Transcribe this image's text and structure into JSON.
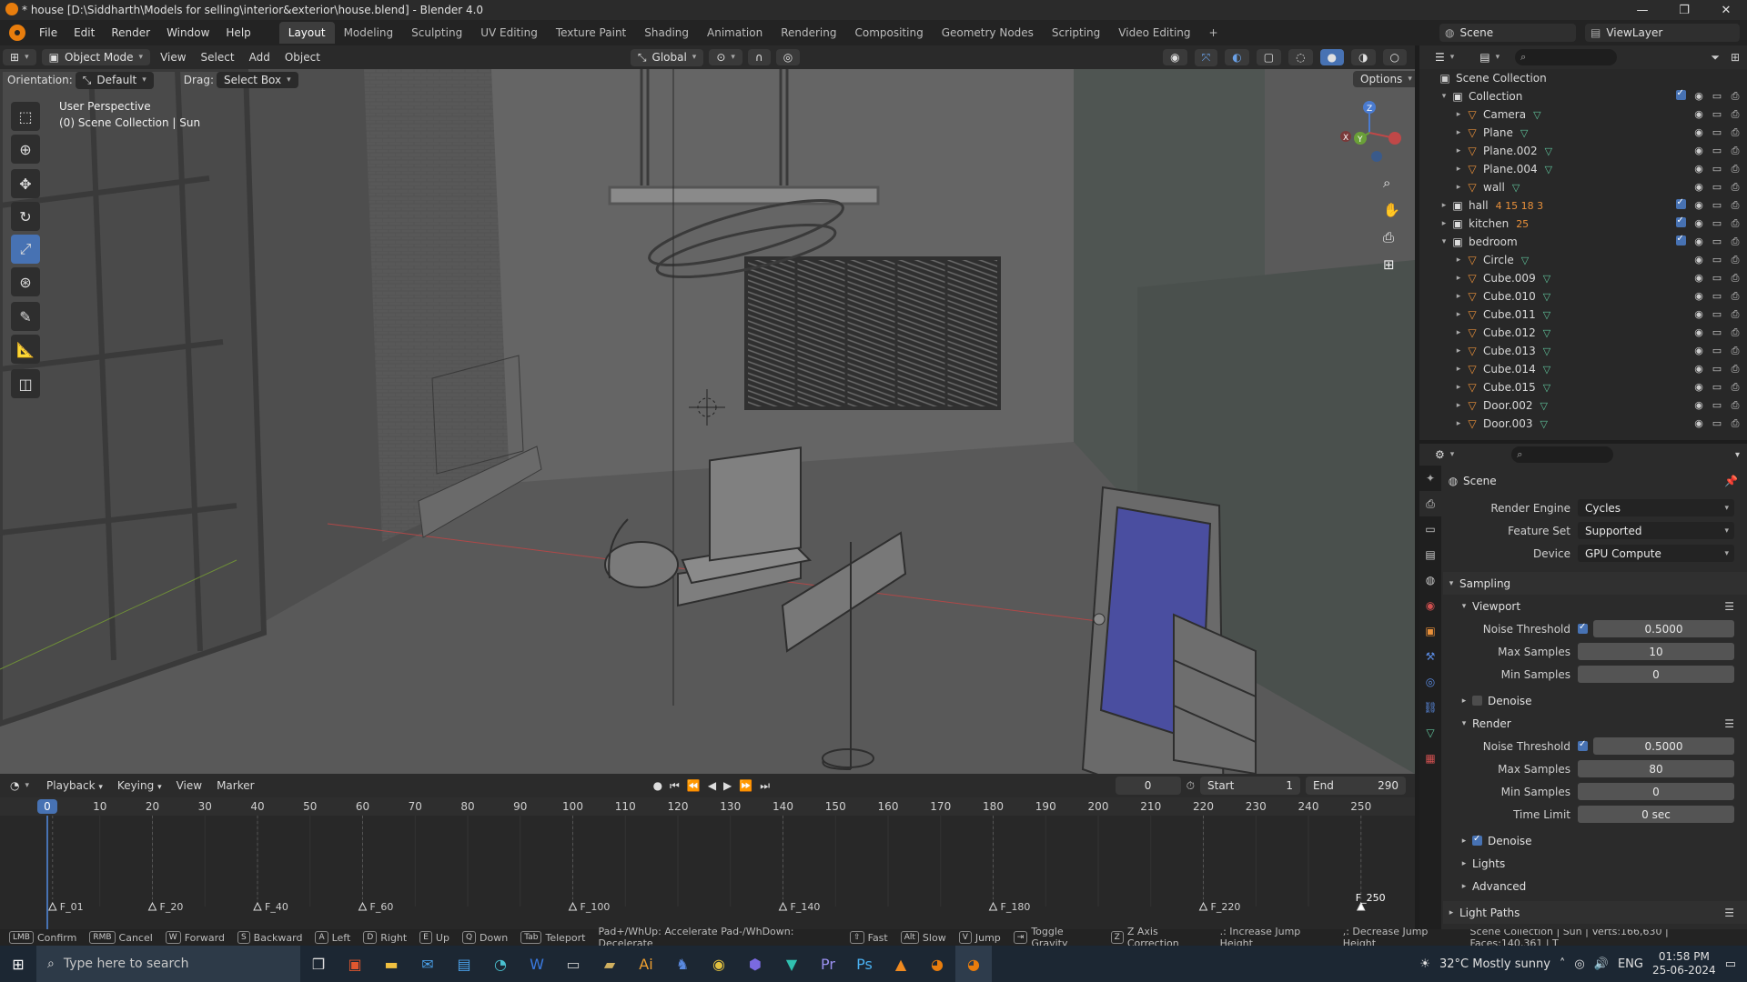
{
  "window": {
    "title": "* house [D:\\Siddharth\\Models for selling\\interior&exterior\\house.blend] - Blender 4.0",
    "minimize": "—",
    "maximize": "❐",
    "close": "✕"
  },
  "menu": {
    "items": [
      "File",
      "Edit",
      "Render",
      "Window",
      "Help"
    ],
    "workspaces": [
      "Layout",
      "Modeling",
      "Sculpting",
      "UV Editing",
      "Texture Paint",
      "Shading",
      "Animation",
      "Rendering",
      "Compositing",
      "Geometry Nodes",
      "Scripting",
      "Video Editing"
    ],
    "active_workspace": "Layout",
    "add_tab": "+",
    "scene": "Scene",
    "view_layer": "ViewLayer"
  },
  "viewport_header": {
    "mode": "Object Mode",
    "menus": [
      "View",
      "Select",
      "Add",
      "Object"
    ],
    "transform": "Global",
    "options": "Options"
  },
  "tool_header": {
    "orientation_label": "Orientation:",
    "orientation_value": "Default",
    "drag_label": "Drag:",
    "drag_value": "Select Box"
  },
  "viewport": {
    "perspective": "User Perspective",
    "context": "(0) Scene Collection | Sun",
    "gizmo": {
      "z": "Z",
      "y": "Y",
      "x": "X"
    }
  },
  "toolbar": {
    "tools": [
      "select-box-icon",
      "cursor-icon",
      "move-icon",
      "rotate-icon",
      "scale-icon",
      "transform-icon",
      "annotate-icon",
      "measure-icon",
      "add-cube-icon"
    ],
    "active_tool": "scale-icon"
  },
  "timeline": {
    "menus": [
      "Playback",
      "Keying",
      "View",
      "Marker"
    ],
    "current_frame": "0",
    "start_label": "Start",
    "start_value": "1",
    "end_label": "End",
    "end_value": "290",
    "ticks": [
      "0",
      "10",
      "20",
      "30",
      "40",
      "50",
      "60",
      "70",
      "80",
      "90",
      "100",
      "110",
      "120",
      "130",
      "140",
      "150",
      "160",
      "170",
      "180",
      "190",
      "200",
      "210",
      "220",
      "230",
      "240",
      "250"
    ],
    "markers": [
      "F_01",
      "F_20",
      "F_40",
      "F_60",
      "F_100",
      "F_140",
      "F_180",
      "F_220",
      "F_250"
    ]
  },
  "outliner": {
    "root": "Scene Collection",
    "rows": [
      {
        "name": "Collection",
        "level": 1,
        "type": "collection",
        "expanded": true
      },
      {
        "name": "Camera",
        "level": 2,
        "type": "object"
      },
      {
        "name": "Plane",
        "level": 2,
        "type": "object"
      },
      {
        "name": "Plane.002",
        "level": 2,
        "type": "object"
      },
      {
        "name": "Plane.004",
        "level": 2,
        "type": "object"
      },
      {
        "name": "wall",
        "level": 2,
        "type": "object"
      },
      {
        "name": "hall",
        "level": 1,
        "type": "collection",
        "expanded": false,
        "badges": "4 15 18 3"
      },
      {
        "name": "kitchen",
        "level": 1,
        "type": "collection",
        "expanded": false,
        "badges": "25"
      },
      {
        "name": "bedroom",
        "level": 1,
        "type": "collection",
        "expanded": true
      },
      {
        "name": "Circle",
        "level": 2,
        "type": "object"
      },
      {
        "name": "Cube.009",
        "level": 2,
        "type": "object"
      },
      {
        "name": "Cube.010",
        "level": 2,
        "type": "object"
      },
      {
        "name": "Cube.011",
        "level": 2,
        "type": "object"
      },
      {
        "name": "Cube.012",
        "level": 2,
        "type": "object"
      },
      {
        "name": "Cube.013",
        "level": 2,
        "type": "object"
      },
      {
        "name": "Cube.014",
        "level": 2,
        "type": "object"
      },
      {
        "name": "Cube.015",
        "level": 2,
        "type": "object"
      },
      {
        "name": "Door.002",
        "level": 2,
        "type": "object"
      },
      {
        "name": "Door.003",
        "level": 2,
        "type": "object"
      }
    ]
  },
  "properties": {
    "context": "Scene",
    "render_engine_label": "Render Engine",
    "render_engine": "Cycles",
    "feature_set_label": "Feature Set",
    "feature_set": "Supported",
    "device_label": "Device",
    "device": "GPU Compute",
    "sampling": "Sampling",
    "viewport": "Viewport",
    "vp_noise_label": "Noise Threshold",
    "vp_noise": "0.5000",
    "vp_max_label": "Max Samples",
    "vp_max": "10",
    "vp_min_label": "Min Samples",
    "vp_min": "0",
    "vp_denoise": "Denoise",
    "render": "Render",
    "r_noise_label": "Noise Threshold",
    "r_noise": "0.5000",
    "r_max_label": "Max Samples",
    "r_max": "80",
    "r_min_label": "Min Samples",
    "r_min": "0",
    "r_time_label": "Time Limit",
    "r_time": "0 sec",
    "r_denoise": "Denoise",
    "lights": "Lights",
    "advanced": "Advanced",
    "light_paths": "Light Paths"
  },
  "statusbar": {
    "items": [
      {
        "key": "LMB",
        "label": "Confirm"
      },
      {
        "key": "RMB",
        "label": "Cancel"
      },
      {
        "key": "W",
        "label": "Forward"
      },
      {
        "key": "S",
        "label": "Backward"
      },
      {
        "key": "A",
        "label": "Left"
      },
      {
        "key": "D",
        "label": "Right"
      },
      {
        "key": "E",
        "label": "Up"
      },
      {
        "key": "Q",
        "label": "Down"
      },
      {
        "key": "Tab",
        "label": "Teleport"
      }
    ],
    "extra": "Pad+/WhUp: Accelerate  Pad-/WhDown: Decelerate",
    "fast": "Fast",
    "alt": "Alt",
    "slow": "Slow",
    "v": "V",
    "jump": "Jump",
    "toggle_gravity": "Toggle Gravity",
    "z": "Z",
    "z_axis": "Z Axis Correction",
    "inc_jump": ".: Increase Jump Height",
    "dec_jump": ",: Decrease Jump Height",
    "stats": "Scene Collection | Sun | Verts:166,630 | Faces:140,361 | T"
  },
  "taskbar": {
    "search_placeholder": "Type here to search",
    "weather": "32°C  Mostly sunny",
    "lang": "ENG",
    "time": "01:58 PM",
    "date": "25-06-2024"
  }
}
